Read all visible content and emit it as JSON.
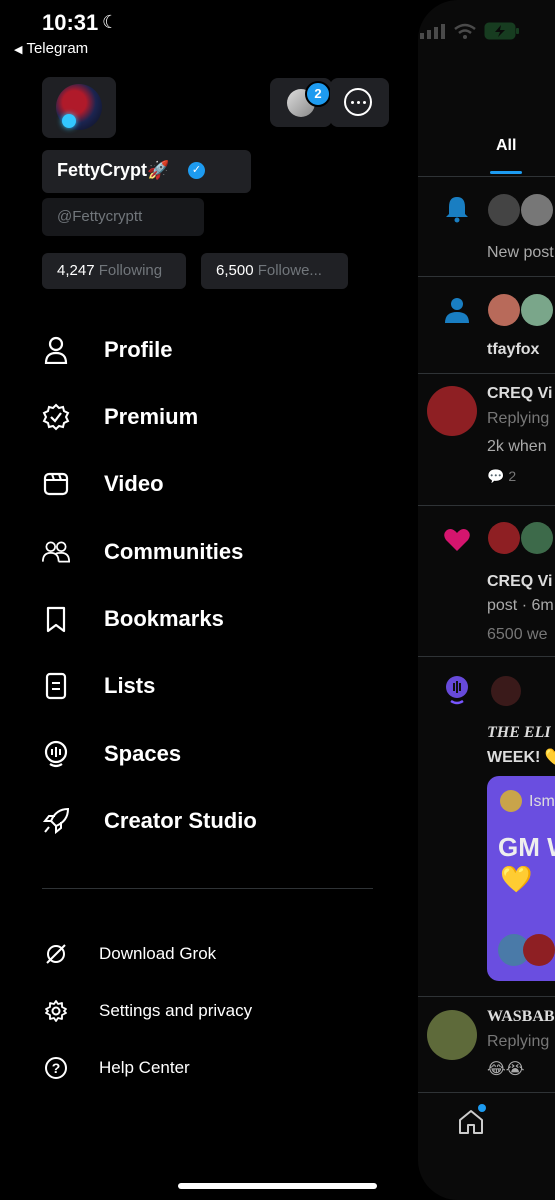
{
  "status": {
    "time": "10:31",
    "back_label": "Telegram"
  },
  "profile": {
    "name": "FettyCrypt🚀",
    "handle": "@Fettycryptt",
    "following_count": "4,247",
    "following_label": "Following",
    "followers_count": "6,500",
    "followers_label": "Followe...",
    "account_badge_count": "2"
  },
  "menu": [
    {
      "label": "Profile",
      "icon": "person-icon"
    },
    {
      "label": "Premium",
      "icon": "premium-badge-icon"
    },
    {
      "label": "Video",
      "icon": "video-icon"
    },
    {
      "label": "Communities",
      "icon": "communities-icon"
    },
    {
      "label": "Bookmarks",
      "icon": "bookmark-icon"
    },
    {
      "label": "Lists",
      "icon": "list-icon"
    },
    {
      "label": "Spaces",
      "icon": "spaces-icon"
    },
    {
      "label": "Creator Studio",
      "icon": "rocket-icon"
    }
  ],
  "secondary_menu": [
    {
      "label": "Download Grok",
      "icon": "grok-icon"
    },
    {
      "label": "Settings and privacy",
      "icon": "gear-icon"
    },
    {
      "label": "Help Center",
      "icon": "help-icon"
    }
  ],
  "background_panel": {
    "tab_all": "All",
    "n1": "New post",
    "n2": "tfayfox",
    "n3_title": "CREQ Vi",
    "n3_sub": "Replying",
    "n3_body": "2k when",
    "n3_replies": "2",
    "n4_title": "CREQ Vi",
    "n4_sub": "post · 6m",
    "n4_body": "6500 we",
    "n5_title": "THE ELI",
    "n5_week": "WEEK! 💛",
    "card_user": "Ism",
    "card_text": "GM W",
    "card_heart": "💛",
    "n6_title": "WASBAB",
    "n6_sub": "Replying",
    "n6_emoji": "😂😭"
  }
}
